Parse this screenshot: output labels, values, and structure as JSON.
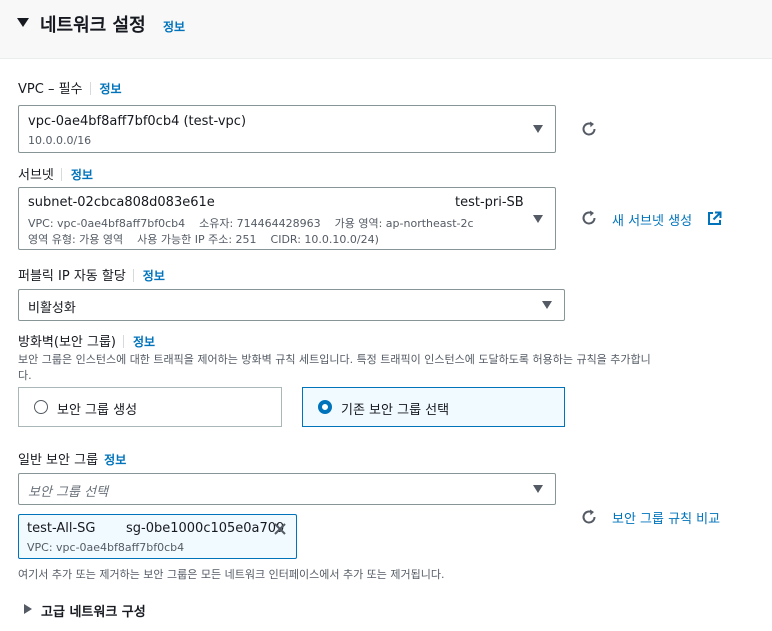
{
  "section": {
    "title": "네트워크 설정",
    "info": "정보"
  },
  "vpc": {
    "label": "VPC – 필수",
    "info": "정보",
    "value": "vpc-0ae4bf8aff7bf0cb4 (test-vpc)",
    "cidr": "10.0.0.0/16"
  },
  "subnet": {
    "label": "서브넷",
    "info": "정보",
    "id": "subnet-02cbca808d083e61e",
    "name": "test-pri-SB",
    "detail1": "VPC: vpc-0ae4bf8aff7bf0cb4    소유자: 714464428963    가용 영역: ap-northeast-2c",
    "detail2": "영역 유형: 가용 영역    사용 가능한 IP 주소: 251    CIDR: 10.0.10.0/24)",
    "create_link": "새 서브넷 생성"
  },
  "public_ip": {
    "label": "퍼블릭 IP 자동 할당",
    "info": "정보",
    "value": "비활성화"
  },
  "firewall": {
    "label": "방화벽(보안 그룹)",
    "info": "정보",
    "description_line1": "보안 그룹은 인스턴스에 대한 트래픽을 제어하는 방화벽 규칙 세트입니다. 특정 트래픽이 인스턴스에 도달하도록 허용하는 규칙을 추가합니",
    "description_line2": "다.",
    "option_create": "보안 그룹 생성",
    "option_existing": "기존 보안 그룹 선택",
    "selected": "기존 보안 그룹 선택"
  },
  "security_groups": {
    "label": "일반 보안 그룹",
    "info": "정보",
    "placeholder": "보안 그룹 선택",
    "compare_link": "보안 그룹 규칙 비교",
    "token": {
      "name": "test-All-SG",
      "id": "sg-0be1000c105e0a709",
      "vpc": "VPC: vpc-0ae4bf8aff7bf0cb4"
    },
    "note": "여기서 추가 또는 제거하는 보안 그룹은 모든 네트워크 인터페이스에서 추가 또는 제거됩니다."
  },
  "advanced": {
    "label": "고급 네트워크 구성"
  },
  "colors": {
    "link": "#0073bb",
    "text": "#16191f",
    "muted": "#545b64",
    "border": "#879596"
  }
}
